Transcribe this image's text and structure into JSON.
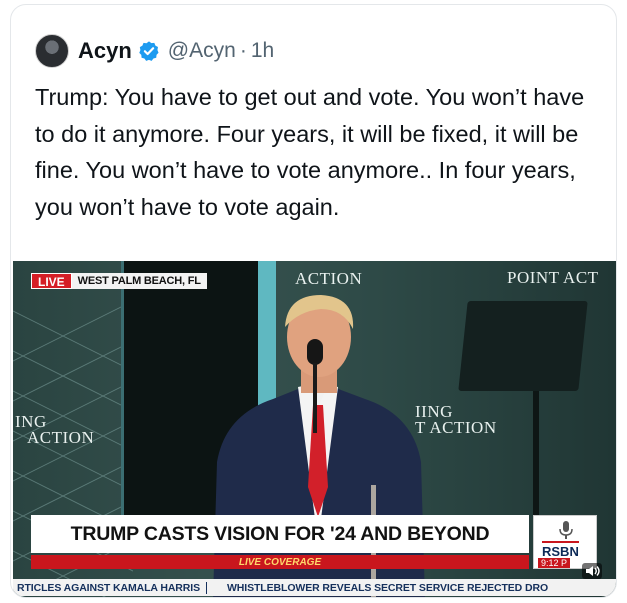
{
  "tweet": {
    "author_name": "Acyn",
    "handle": "@Acyn",
    "separator": "·",
    "time": "1h",
    "text": "Trump: You have to get out and vote. You won’t have to do it anymore. Four years, it will be fixed, it will be fine. You won’t have to vote anymore.. In four years, you won’t have to vote again."
  },
  "video": {
    "live_label": "LIVE",
    "location": "WEST PALM BEACH, FL",
    "stage_text_top_center": "ACTION",
    "stage_text_top_right": "POINT ACT",
    "stage_text_left_1": "ING",
    "stage_text_left_2": "ACTION",
    "stage_text_right_1": "IING",
    "stage_text_right_2": "T ACTION",
    "headline": "TRUMP CASTS VISION FOR '24 AND BEYOND",
    "live_coverage": "LIVE COVERAGE",
    "network_logo": "RSBN",
    "clock": "9:12 P",
    "ticker_items": [
      "RTICLES AGAINST KAMALA HARRIS",
      "WHISTLEBLOWER REVEALS SECRET SERVICE REJECTED DRO"
    ]
  },
  "colors": {
    "verified_blue": "#1d9bf0",
    "live_red": "#d51e26",
    "headline_red": "#c9161d"
  }
}
